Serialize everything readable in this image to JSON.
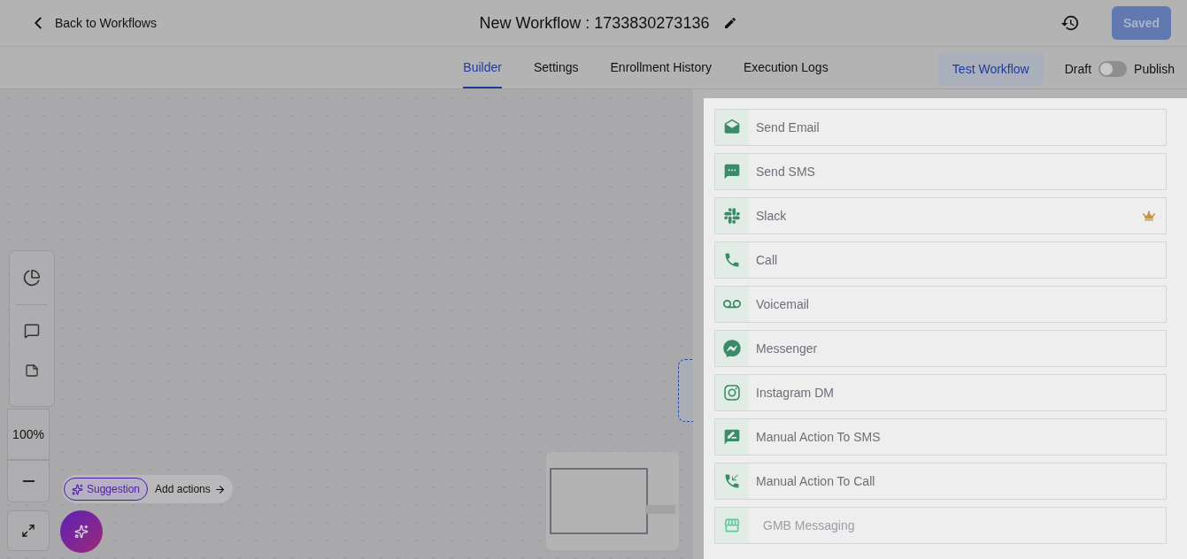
{
  "header": {
    "back_label": "Back to Workflows",
    "title": "New Workflow : 1733830273136",
    "save_button": {
      "label": "Saved",
      "disabled": true
    }
  },
  "tabs": [
    {
      "label": "Builder",
      "selected": true
    },
    {
      "label": "Settings",
      "selected": false
    },
    {
      "label": "Enrollment History",
      "selected": false
    },
    {
      "label": "Execution Logs",
      "selected": false
    }
  ],
  "test_button": "Test Workflow",
  "publish_toggle": {
    "off_label": "Draft",
    "on_label": "Publish",
    "on": false
  },
  "canvas": {
    "zoom": "100%",
    "suggestion": "Suggestion",
    "add_actions": "Add actions"
  },
  "actions": [
    {
      "label": "Send Email",
      "kind": "email",
      "premium": false,
      "disabled": false
    },
    {
      "label": "Send SMS",
      "kind": "sms",
      "premium": false,
      "disabled": false
    },
    {
      "label": "Slack",
      "kind": "slack",
      "premium": true,
      "disabled": false
    },
    {
      "label": "Call",
      "kind": "call",
      "premium": false,
      "disabled": false
    },
    {
      "label": "Voicemail",
      "kind": "voicemail",
      "premium": false,
      "disabled": false
    },
    {
      "label": "Messenger",
      "kind": "messenger",
      "premium": false,
      "disabled": false
    },
    {
      "label": "Instagram DM",
      "kind": "instagram",
      "premium": false,
      "disabled": false
    },
    {
      "label": "Manual Action To SMS",
      "kind": "manual_sms",
      "premium": false,
      "disabled": false
    },
    {
      "label": "Manual Action To Call",
      "kind": "manual_call",
      "premium": false,
      "disabled": false
    },
    {
      "label": "GMB Messaging",
      "kind": "gmb",
      "premium": false,
      "disabled": true
    }
  ]
}
